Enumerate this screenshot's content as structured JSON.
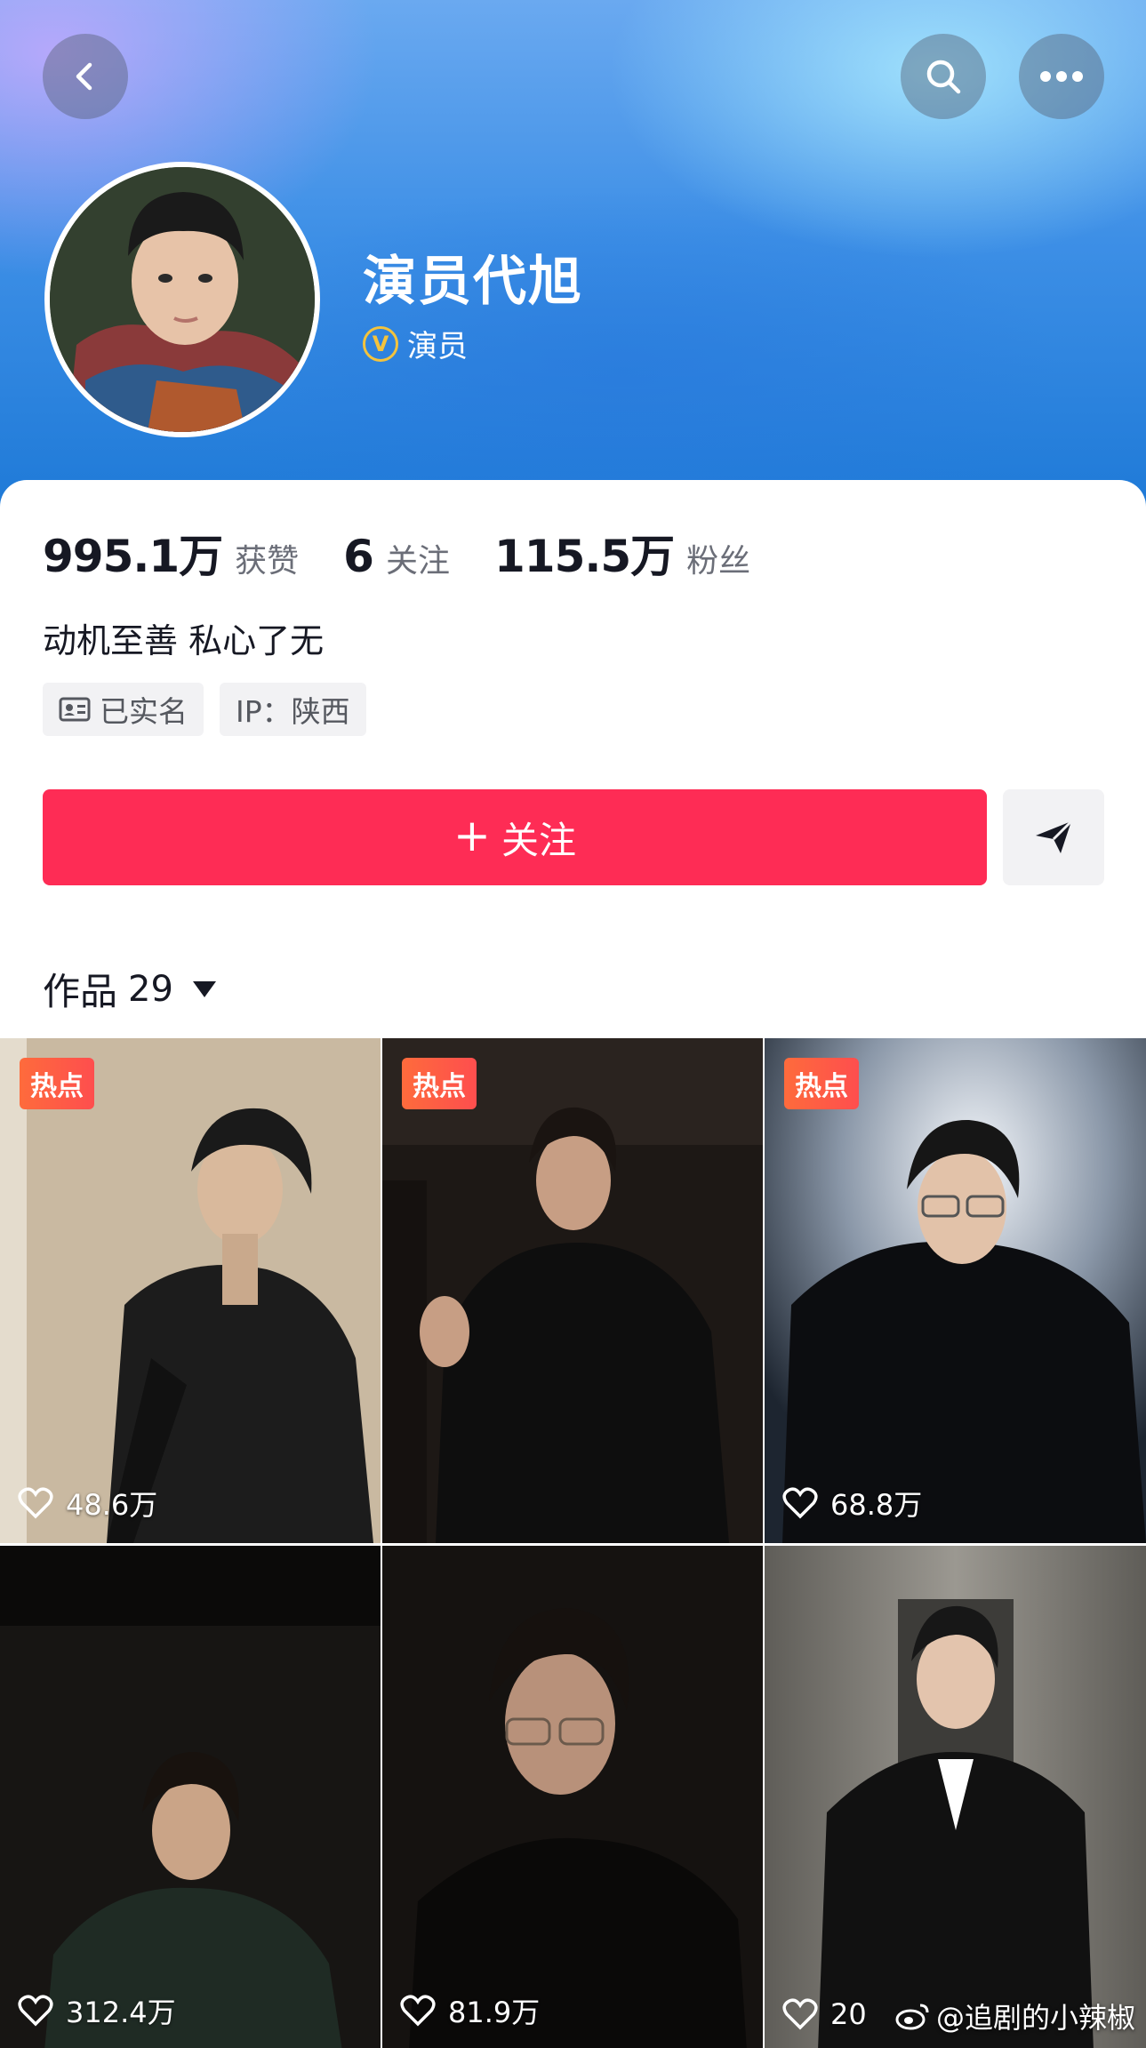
{
  "profile": {
    "name": "演员代旭",
    "verify_label": "演员"
  },
  "stats": [
    {
      "value": "995.1万",
      "label": "获赞"
    },
    {
      "value": "6",
      "label": "关注"
    },
    {
      "value": "115.5万",
      "label": "粉丝"
    }
  ],
  "bio": "动机至善 私心了无",
  "tags": {
    "real_name": "已实名",
    "ip": "IP：陕西"
  },
  "actions": {
    "follow_plus": "+",
    "follow_label": "关注"
  },
  "works": {
    "label": "作品",
    "count": "29"
  },
  "videos": [
    {
      "hot": "热点",
      "likes": "48.6万"
    },
    {
      "hot": "热点",
      "likes": ""
    },
    {
      "hot": "热点",
      "likes": "68.8万"
    },
    {
      "hot": "",
      "likes": "312.4万"
    },
    {
      "hot": "",
      "likes": "81.9万"
    },
    {
      "hot": "",
      "likes": "20"
    }
  ],
  "watermark": "@追剧的小辣椒",
  "colors": {
    "accent": "#fe2c55",
    "hot_badge": "#fe5a44",
    "verify": "#f3c33d"
  }
}
